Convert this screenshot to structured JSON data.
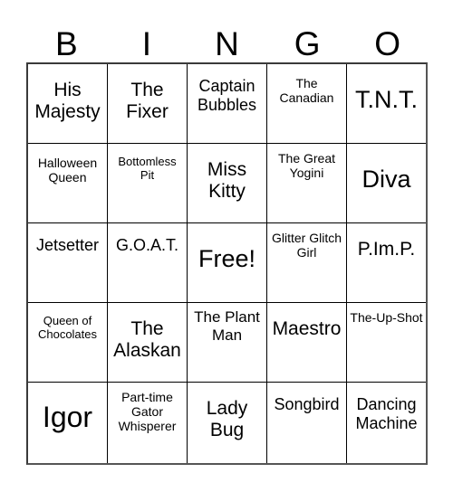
{
  "card": {
    "headers": [
      "B",
      "I",
      "N",
      "G",
      "O"
    ],
    "rows": [
      [
        {
          "text": "His Majesty",
          "size": "md"
        },
        {
          "text": "The Fixer",
          "size": "md"
        },
        {
          "text": "Captain Bubbles",
          "size": "sm"
        },
        {
          "text": "The Canadian",
          "size": "xs"
        },
        {
          "text": "T.N.T.",
          "size": "lg"
        }
      ],
      [
        {
          "text": "Halloween Queen",
          "size": "xs"
        },
        {
          "text": "Bottomless Pit",
          "size": "xxs"
        },
        {
          "text": "Miss Kitty",
          "size": "md"
        },
        {
          "text": "The Great Yogini",
          "size": "3ln"
        },
        {
          "text": "Diva",
          "size": "lg"
        }
      ],
      [
        {
          "text": "Jetsetter",
          "size": "sm"
        },
        {
          "text": "G.O.A.T.",
          "size": "sm"
        },
        {
          "text": "Free!",
          "size": "lg"
        },
        {
          "text": "Glitter Glitch Girl",
          "size": "3ln"
        },
        {
          "text": "P.Im.P.",
          "size": "md"
        }
      ],
      [
        {
          "text": "Queen of Chocolates",
          "size": "xxs"
        },
        {
          "text": "The Alaskan",
          "size": "md"
        },
        {
          "text": "The Plant Man",
          "size": "3lnm"
        },
        {
          "text": "Maestro",
          "size": "md"
        },
        {
          "text": "The-Up-Shot",
          "size": "3ln"
        }
      ],
      [
        {
          "text": "Igor",
          "size": "xl"
        },
        {
          "text": "Part-time Gator Whisperer",
          "size": "3ln"
        },
        {
          "text": "Lady Bug",
          "size": "md"
        },
        {
          "text": "Songbird",
          "size": "sm"
        },
        {
          "text": "Dancing Machine",
          "size": "sm"
        }
      ]
    ]
  }
}
